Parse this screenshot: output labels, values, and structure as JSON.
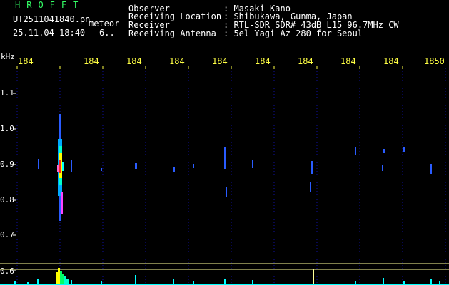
{
  "header": {
    "logo": "HROFFT",
    "filename": "UT2511041840.pn",
    "tag": "meteor",
    "datetime": "25.11.04 18:40",
    "count": "6..",
    "fields": [
      {
        "label": "Observer",
        "value": ": Masaki Kano"
      },
      {
        "label": "Receiving Location",
        "value": ": Shibukawa, Gunma, Japan"
      },
      {
        "label": "Receiver",
        "value": ": RTL-SDR SDR# 43dB L15 96.7MHz CW"
      },
      {
        "label": "Receiving Antenna",
        "value": ": 5el Yagi Az 280 for Seoul"
      }
    ]
  },
  "axis": {
    "unit": "kHz",
    "x_ticks": [
      "184",
      "184",
      "184",
      "184",
      "184",
      "184",
      "184",
      "184",
      "184",
      "1850"
    ],
    "y_ticks": [
      "1.1",
      "1.0",
      "0.9",
      "0.8",
      "0.7",
      "0.6"
    ]
  },
  "colors": {
    "background": "#000000",
    "header_green": "#33ff66",
    "tick_yellow": "#ffff44",
    "grid_blue": "#1010a0",
    "signal_blue": "#2a5cff",
    "meteor_hot": "#ff2222",
    "meteor_mid": "#ffff00",
    "meteor_cool": "#00ffff",
    "histogram": "#00ffff",
    "baseline": "#ffff99"
  }
}
